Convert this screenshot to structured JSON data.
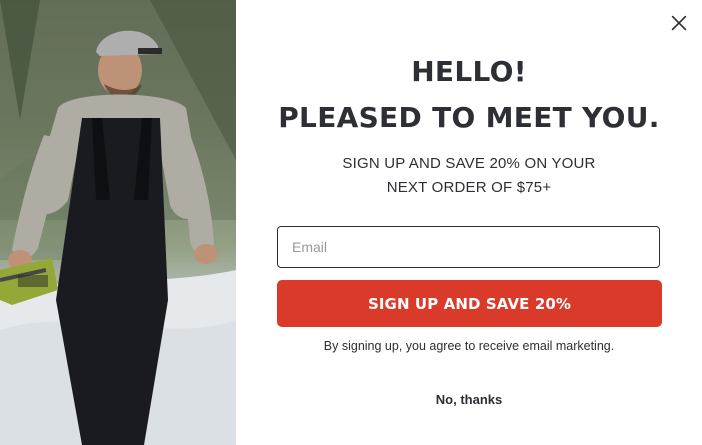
{
  "modal": {
    "heading_line1": "HELLO!",
    "heading_line2": "PLEASED TO MEET YOU.",
    "subtitle_line1": "SIGN UP AND SAVE 20% ON YOUR",
    "subtitle_line2": "NEXT ORDER OF $75+",
    "email_placeholder": "Email",
    "email_value": "",
    "cta_label": "SIGN UP AND SAVE 20%",
    "legal_text": "By signing up, you agree to receive email marketing.",
    "decline_label": "No, thanks"
  },
  "icons": {
    "close": "close-icon"
  },
  "colors": {
    "cta_background": "#da3a2a",
    "text": "#2d2f34"
  }
}
